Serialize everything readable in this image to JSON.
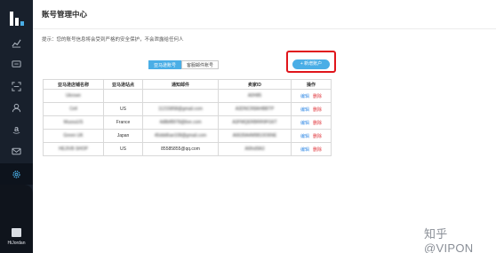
{
  "sidebar": {
    "logo_icon": "bar-logo-icon",
    "items": [
      {
        "icon": "trend-chart-icon"
      },
      {
        "icon": "message-icon"
      },
      {
        "icon": "scan-icon"
      },
      {
        "icon": "user-icon"
      },
      {
        "icon": "amazon-icon"
      },
      {
        "icon": "mail-icon"
      },
      {
        "icon": "settings-icon"
      }
    ],
    "active_item": "settings-icon",
    "user_name": "HiJordan"
  },
  "header": {
    "title": "账号管理中心"
  },
  "main": {
    "hint": "提示：您的账号信息将会受到严格的安全保护，不会泄露给任何人",
    "tabs": [
      {
        "label": "亚马逊账号",
        "active": true
      },
      {
        "label": "客服邮件账号",
        "active": false
      }
    ],
    "add_button_label": "+ 新增账户"
  },
  "table": {
    "headers": [
      "亚马逊店铺名称",
      "亚马逊站点",
      "通知邮件",
      "卖家ID",
      "操作"
    ],
    "rows": [
      {
        "store": "Ukrown",
        "site": "",
        "email": "",
        "seller": "A0H85",
        "edit": "编辑",
        "delete": "删除"
      },
      {
        "store": "Cell",
        "site": "US",
        "email": "11215858@gmail.com",
        "seller": "A3DNCR8AHBBTP",
        "edit": "编辑",
        "delete": "删除"
      },
      {
        "store": "MussuUS",
        "site": "France",
        "email": "4d8bf8978@live.com",
        "seller": "A3FMQERBRR9FG6T",
        "edit": "编辑",
        "delete": "删除"
      },
      {
        "store": "Green UK",
        "site": "Japan",
        "email": "45ddd6ae108@gmail.com",
        "seller": "A6639A4M9810O6NE",
        "edit": "编辑",
        "delete": "删除"
      },
      {
        "store": "HEJIVB SHOP",
        "site": "US",
        "email": "85585855@qq.com",
        "seller": "A6fnd9A3",
        "edit": "编辑",
        "delete": "删除"
      }
    ]
  },
  "watermark": "知乎 @VIPON",
  "colors": {
    "sidebar": "#18202c",
    "accent": "#4aaee6",
    "highlight_box": "#e0151b",
    "delete_action": "#e0353b",
    "edit_action": "#3a8ee6"
  }
}
